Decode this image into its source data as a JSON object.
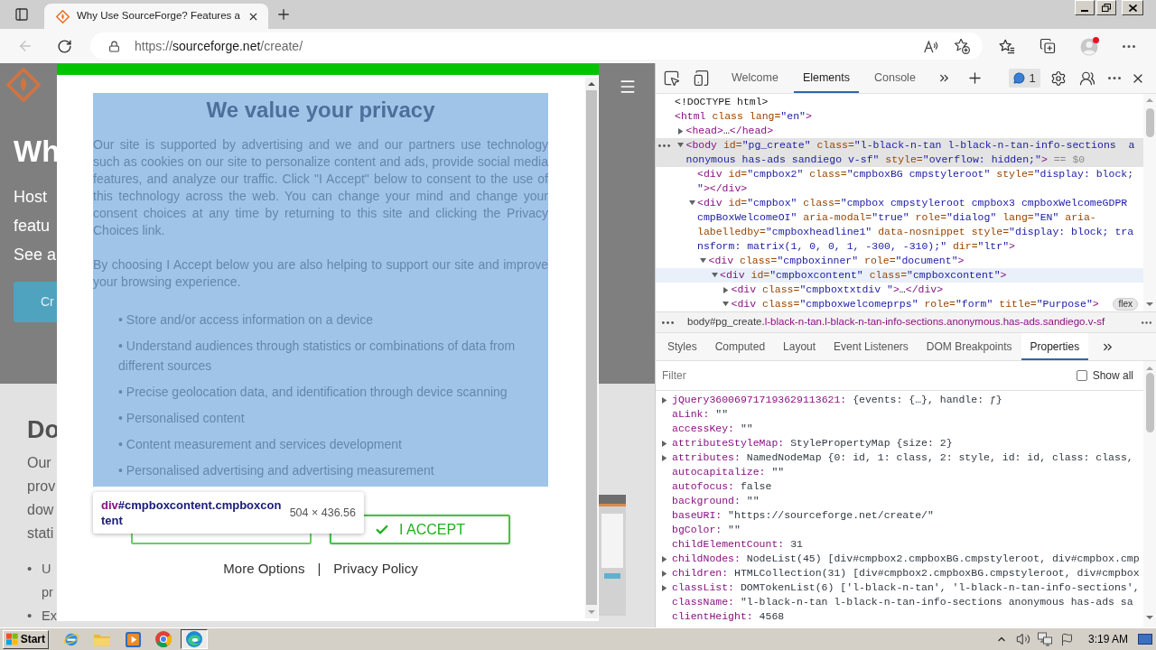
{
  "browser": {
    "tab": {
      "title": "Why Use SourceForge? Features a",
      "selected": true
    },
    "nav": {
      "back_disabled": true
    },
    "address": {
      "scheme": "https://",
      "host": "sourceforge.net",
      "path": "/create/"
    }
  },
  "page": {
    "heading": "Wh",
    "intro_lines": [
      "Host",
      "featu",
      "See a"
    ],
    "cta": "Cr",
    "section_heading": "Do",
    "section_lines": [
      "Our",
      "prov",
      "dow",
      "stati"
    ],
    "bullets": [
      {
        "marker": "•",
        "lines": [
          "U",
          "pr"
        ]
      },
      {
        "marker": "•",
        "lines": [
          "Ex"
        ]
      }
    ]
  },
  "consent": {
    "title": "We value your privacy",
    "paragraphs": [
      "Our site is supported by advertising and we and our partners use technology such as cookies on our site to personalize content and ads, provide social media features, and analyze our traffic. Click \"I Accept\" below to consent to the use of this technology across the web. You can change your mind and change your consent choices at any time by returning to this site and clicking the Privacy Choices link.",
      "By choosing I Accept below you are also helping to support our site and improve your browsing experience."
    ],
    "purposes": [
      "• Store and/or access information on a device",
      "• Understand audiences through statistics or combinations of data from different sources",
      "• Precise geolocation data, and identification through device scanning",
      "• Personalised content",
      "• Content measurement and services development",
      "• Personalised advertising and advertising measurement"
    ],
    "buttons": [
      {
        "kind": "blank"
      },
      {
        "kind": "check",
        "label": "I ACCEPT"
      }
    ],
    "links": [
      "More Options",
      "Privacy Policy"
    ],
    "separator": "|"
  },
  "inspect_tooltip": {
    "tag": "div",
    "selector": "#cmpboxcontent.cmpboxcontent",
    "size": "504 × 436.56"
  },
  "devtools": {
    "tabs": [
      {
        "label": "Welcome",
        "selected": false
      },
      {
        "label": "Elements",
        "selected": true
      },
      {
        "label": "Console",
        "selected": false
      }
    ],
    "issues_count": "1",
    "elements_tree": [
      {
        "lines": [
          [
            {
              "kind": "text",
              "text": "<!DOCTYPE html>"
            }
          ]
        ],
        "selected": false,
        "hovered": false
      },
      {
        "lines": [
          [
            {
              "kind": "tag",
              "text": "<html"
            },
            {
              "kind": "attr",
              "text": " class lang="
            },
            {
              "kind": "value",
              "text": "\"en\""
            },
            {
              "kind": "tag",
              "text": ">"
            }
          ]
        ],
        "selected": false,
        "hovered": false,
        "children": [
          {
            "lines": [
              [
                {
                  "kind": "tag",
                  "text": "<head>"
                },
                {
                  "kind": "text",
                  "text": "…"
                },
                {
                  "kind": "tag",
                  "text": "</head>"
                }
              ]
            ],
            "expanded": false,
            "selected": false,
            "hovered": false
          },
          {
            "lines": [
              [
                {
                  "kind": "tag",
                  "text": "<body"
                },
                {
                  "kind": "attr",
                  "text": " id="
                },
                {
                  "kind": "value",
                  "text": "\"pg_create\""
                },
                {
                  "kind": "attr",
                  "text": " class="
                },
                {
                  "kind": "value",
                  "text": "\"l-black-n-tan l-black-n-tan-info-sections  a"
                }
              ],
              [
                {
                  "kind": "value",
                  "text": "nonymous has-ads sandiego v-sf\""
                },
                {
                  "kind": "attr",
                  "text": " style="
                },
                {
                  "kind": "value",
                  "text": "\"overflow: hidden;\""
                },
                {
                  "kind": "tag",
                  "text": ">"
                },
                {
                  "kind": "muted",
                  "text": " == $0"
                }
              ]
            ],
            "expanded": true,
            "selected": true,
            "hovered": false,
            "children": [
              {
                "lines": [
                  [
                    {
                      "kind": "tag",
                      "text": "<div"
                    },
                    {
                      "kind": "attr",
                      "text": " id="
                    },
                    {
                      "kind": "value",
                      "text": "\"cmpbox2\""
                    },
                    {
                      "kind": "attr",
                      "text": " class="
                    },
                    {
                      "kind": "value",
                      "text": "\"cmpboxBG cmpstyleroot\""
                    },
                    {
                      "kind": "attr",
                      "text": " style="
                    },
                    {
                      "kind": "value",
                      "text": "\"display: block;"
                    }
                  ],
                  [
                    {
                      "kind": "value",
                      "text": "\""
                    },
                    {
                      "kind": "tag",
                      "text": "></div>"
                    }
                  ]
                ],
                "selected": false,
                "hovered": false
              },
              {
                "lines": [
                  [
                    {
                      "kind": "tag",
                      "text": "<div"
                    },
                    {
                      "kind": "attr",
                      "text": " id="
                    },
                    {
                      "kind": "value",
                      "text": "\"cmpbox\""
                    },
                    {
                      "kind": "attr",
                      "text": " class="
                    },
                    {
                      "kind": "value",
                      "text": "\"cmpbox cmpstyleroot cmpbox3 cmpboxWelcomeGDPR"
                    }
                  ],
                  [
                    {
                      "kind": "value",
                      "text": "cmpBoxWelcomeOI\""
                    },
                    {
                      "kind": "attr",
                      "text": " aria-modal="
                    },
                    {
                      "kind": "value",
                      "text": "\"true\""
                    },
                    {
                      "kind": "attr",
                      "text": " role="
                    },
                    {
                      "kind": "value",
                      "text": "\"dialog\""
                    },
                    {
                      "kind": "attr",
                      "text": " lang="
                    },
                    {
                      "kind": "value",
                      "text": "\"EN\""
                    },
                    {
                      "kind": "attr",
                      "text": " aria-"
                    }
                  ],
                  [
                    {
                      "kind": "attr",
                      "text": "labelledby="
                    },
                    {
                      "kind": "value",
                      "text": "\"cmpboxheadline1\""
                    },
                    {
                      "kind": "attr",
                      "text": " data-nosnippet style="
                    },
                    {
                      "kind": "value",
                      "text": "\"display: block; tra"
                    }
                  ],
                  [
                    {
                      "kind": "value",
                      "text": "nsform: matrix(1, 0, 0, 1, -300, -310);\""
                    },
                    {
                      "kind": "attr",
                      "text": " dir="
                    },
                    {
                      "kind": "value",
                      "text": "\"ltr\""
                    },
                    {
                      "kind": "tag",
                      "text": ">"
                    }
                  ]
                ],
                "expanded": true,
                "selected": false,
                "hovered": false,
                "children": [
                  {
                    "lines": [
                      [
                        {
                          "kind": "tag",
                          "text": "<div"
                        },
                        {
                          "kind": "attr",
                          "text": " class="
                        },
                        {
                          "kind": "value",
                          "text": "\"cmpboxinner\""
                        },
                        {
                          "kind": "attr",
                          "text": " role="
                        },
                        {
                          "kind": "value",
                          "text": "\"document\""
                        },
                        {
                          "kind": "tag",
                          "text": ">"
                        }
                      ]
                    ],
                    "expanded": true,
                    "selected": false,
                    "hovered": false,
                    "children": [
                      {
                        "lines": [
                          [
                            {
                              "kind": "tag",
                              "text": "<div"
                            },
                            {
                              "kind": "attr",
                              "text": " id="
                            },
                            {
                              "kind": "value",
                              "text": "\"cmpboxcontent\""
                            },
                            {
                              "kind": "attr",
                              "text": " class="
                            },
                            {
                              "kind": "value",
                              "text": "\"cmpboxcontent\""
                            },
                            {
                              "kind": "tag",
                              "text": ">"
                            }
                          ]
                        ],
                        "expanded": true,
                        "selected": false,
                        "hovered": true,
                        "children": [
                          {
                            "lines": [
                              [
                                {
                                  "kind": "tag",
                                  "text": "<div"
                                },
                                {
                                  "kind": "attr",
                                  "text": " class="
                                },
                                {
                                  "kind": "value",
                                  "text": "\"cmpboxtxtdiv \""
                                },
                                {
                                  "kind": "tag",
                                  "text": ">"
                                },
                                {
                                  "kind": "text",
                                  "text": "…"
                                },
                                {
                                  "kind": "tag",
                                  "text": "</div>"
                                }
                              ]
                            ],
                            "expanded": false,
                            "selected": false,
                            "hovered": false
                          },
                          {
                            "lines": [
                              [
                                {
                                  "kind": "tag",
                                  "text": "<div"
                                },
                                {
                                  "kind": "attr",
                                  "text": " class="
                                },
                                {
                                  "kind": "value",
                                  "text": "\"cmpboxwelcomeprps\""
                                },
                                {
                                  "kind": "attr",
                                  "text": " role="
                                },
                                {
                                  "kind": "value",
                                  "text": "\"form\""
                                },
                                {
                                  "kind": "attr",
                                  "text": " title="
                                },
                                {
                                  "kind": "value",
                                  "text": "\"Purpose\""
                                },
                                {
                                  "kind": "tag",
                                  "text": ">"
                                }
                              ]
                            ],
                            "expanded": true,
                            "badge": "flex",
                            "selected": false,
                            "hovered": false
                          }
                        ]
                      }
                    ]
                  }
                ]
              }
            ]
          }
        ]
      }
    ],
    "breadcrumb": {
      "element": "body#pg_create",
      "classes": ".l-black-n-tan.l-black-n-tan-info-sections.anonymous.has-ads.sandiego.v-sf"
    },
    "panel_tabs": [
      {
        "label": "Styles",
        "selected": false
      },
      {
        "label": "Computed",
        "selected": false
      },
      {
        "label": "Layout",
        "selected": false
      },
      {
        "label": "Event Listeners",
        "selected": false
      },
      {
        "label": "DOM Breakpoints",
        "selected": false
      },
      {
        "label": "Properties",
        "selected": true
      }
    ],
    "filter": {
      "placeholder": "Filter"
    },
    "show_all": {
      "label": "Show all",
      "checked": false
    },
    "properties": [
      {
        "name": "jQuery360069717193629113621:",
        "value": "{events: {…}, handle: ƒ}",
        "expandable": true
      },
      {
        "name": "aLink:",
        "value": "\"\"",
        "expandable": false
      },
      {
        "name": "accessKey:",
        "value": "\"\"",
        "expandable": false
      },
      {
        "name": "attributeStyleMap:",
        "value": "StylePropertyMap {size: 2}",
        "expandable": true
      },
      {
        "name": "attributes:",
        "value": "NamedNodeMap {0: id, 1: class, 2: style, id: id, class: class,",
        "expandable": true
      },
      {
        "name": "autocapitalize:",
        "value": "\"\"",
        "expandable": false
      },
      {
        "name": "autofocus:",
        "value": "false",
        "expandable": false
      },
      {
        "name": "background:",
        "value": "\"\"",
        "expandable": false
      },
      {
        "name": "baseURI:",
        "value": "\"https://sourceforge.net/create/\"",
        "expandable": false
      },
      {
        "name": "bgColor:",
        "value": "\"\"",
        "expandable": false
      },
      {
        "name": "childElementCount:",
        "value": "31",
        "expandable": false
      },
      {
        "name": "childNodes:",
        "value": "NodeList(45) [div#cmpbox2.cmpboxBG.cmpstyleroot, div#cmpbox.cmp",
        "expandable": true
      },
      {
        "name": "children:",
        "value": "HTMLCollection(31) [div#cmpbox2.cmpboxBG.cmpstyleroot, div#cmpbox",
        "expandable": true
      },
      {
        "name": "classList:",
        "value": "DOMTokenList(6) ['l-black-n-tan', 'l-black-n-tan-info-sections',",
        "expandable": true
      },
      {
        "name": "className:",
        "value": "\"l-black-n-tan l-black-n-tan-info-sections anonymous has-ads sa",
        "expandable": false
      },
      {
        "name": "clientHeight:",
        "value": "4568",
        "expandable": false
      }
    ]
  },
  "taskbar": {
    "start": "Start",
    "apps": [
      {
        "kind": "orbit",
        "selected": false
      },
      {
        "kind": "folder",
        "selected": false
      },
      {
        "kind": "player",
        "selected": false
      },
      {
        "kind": "ring",
        "selected": false
      },
      {
        "kind": "swirl",
        "selected": true
      }
    ],
    "clock": "3:19 AM"
  }
}
